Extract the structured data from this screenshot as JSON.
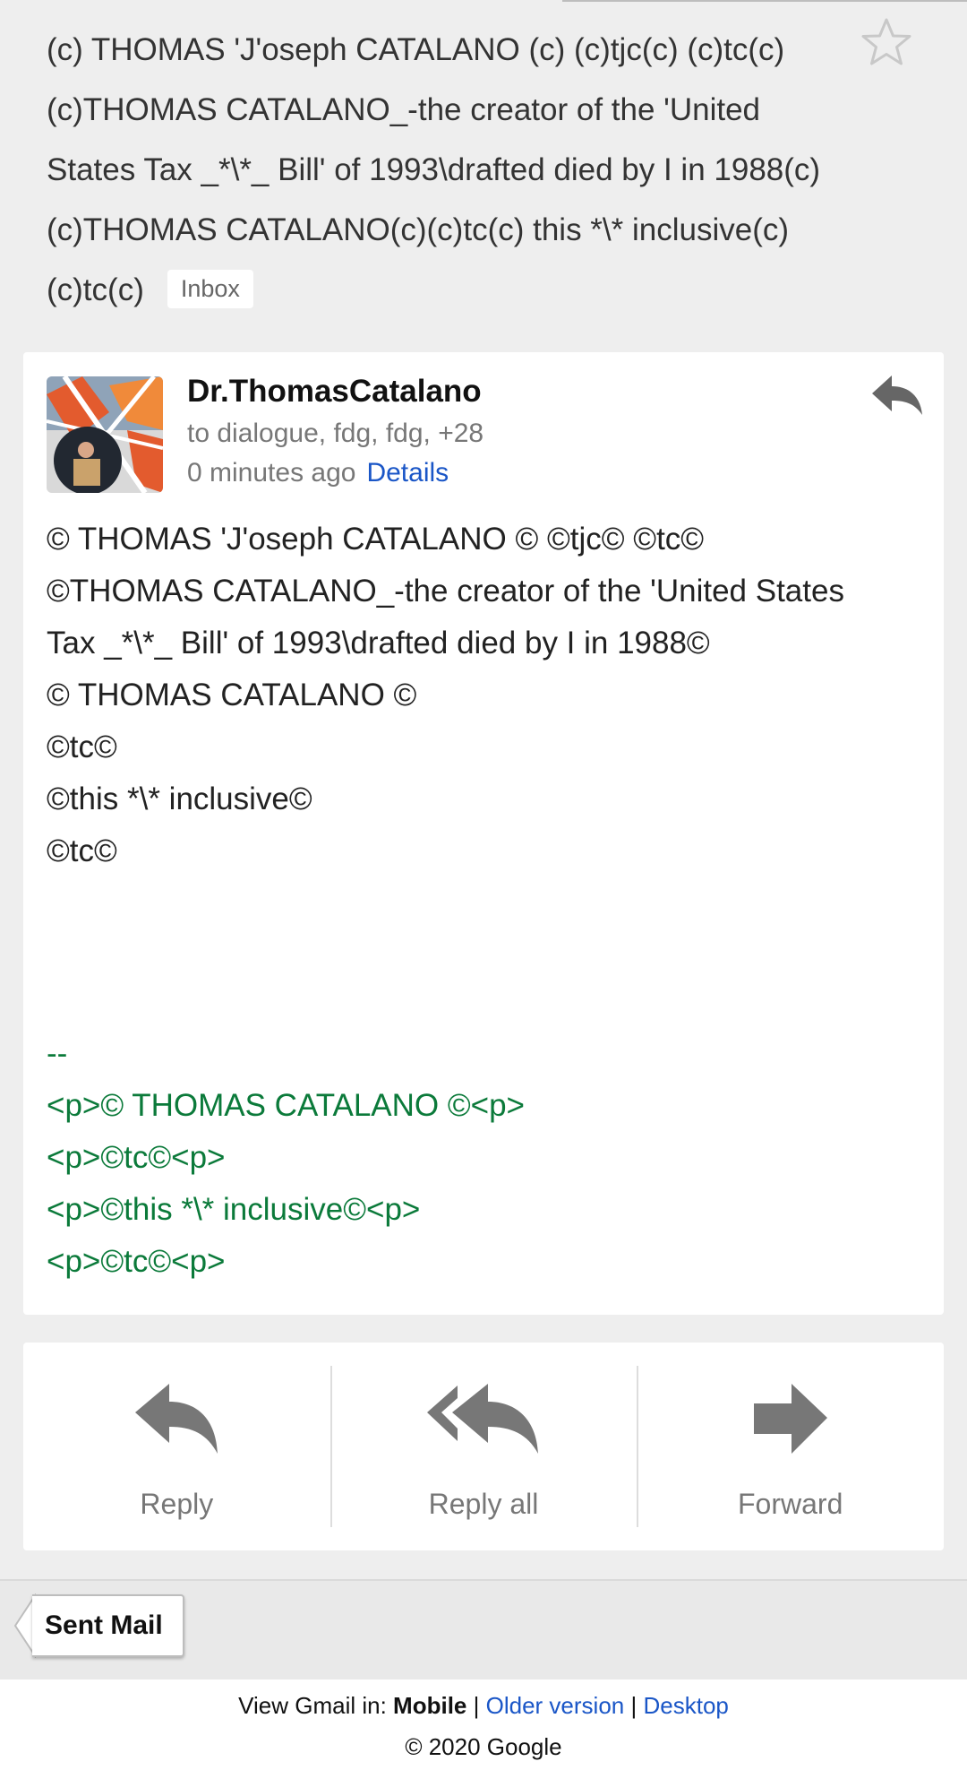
{
  "subject": {
    "lines": [
      "(c) THOMAS 'J'oseph CATALANO (c) (c)tjc(c) (c)tc(c)",
      "(c)THOMAS CATALANO_-the creator of the 'United",
      "States Tax _*\\*_ Bill' of 1993\\drafted died by I in 1988(c)",
      "(c)THOMAS CATALANO(c)(c)tc(c) this *\\* inclusive(c)",
      "(c)tc(c)"
    ],
    "label": "Inbox",
    "star_icon": "star-outline-icon"
  },
  "message": {
    "sender": "Dr.ThomasCatalano",
    "recipients": "to dialogue, fdg, fdg, +28",
    "time": "0 minutes ago",
    "details_link": "Details",
    "reply_icon": "reply-arrow-icon",
    "body_lines": [
      "© THOMAS 'J'oseph CATALANO © ©tjc© ©tc©",
      "©THOMAS CATALANO_-the creator of the 'United States",
      "Tax _*\\*_ Bill' of 1993\\drafted died by I in 1988©",
      "© THOMAS CATALANO ©",
      "©tc©",
      "©this *\\* inclusive©",
      "©tc©"
    ],
    "signature_dash": "--",
    "signature_lines": [
      "<p>© THOMAS CATALANO ©<p>",
      "<p>©tc©<p>",
      "<p>©this *\\* inclusive©<p>",
      "<p>©tc©<p>"
    ]
  },
  "actions": {
    "reply": "Reply",
    "reply_all": "Reply all",
    "forward": "Forward"
  },
  "nav": {
    "back_label": "Sent Mail"
  },
  "footer": {
    "view_in": "View Gmail in:",
    "mobile": "Mobile",
    "sep1": "|",
    "older": "Older version",
    "sep2": "|",
    "desktop": "Desktop",
    "copyright": "© 2020 Google"
  },
  "colors": {
    "link": "#1a56c7",
    "signature": "#0b7a3a",
    "icon_gray": "#777777"
  }
}
